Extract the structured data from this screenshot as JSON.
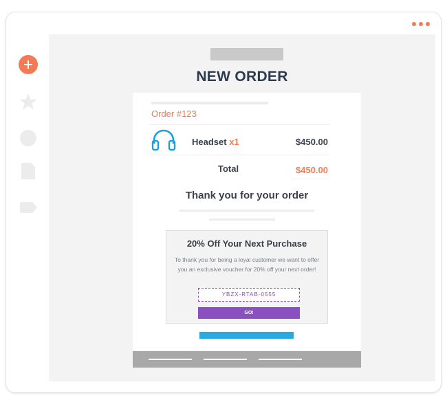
{
  "colors": {
    "accent": "#f47a55",
    "title": "#2d3b4f",
    "voucher_purple": "#8a4fc0",
    "cta_blue": "#2aa8e0",
    "icon_blue": "#1e9ee0"
  },
  "window": {
    "menu_icon": "ellipsis-icon"
  },
  "sidebar": {
    "items": [
      {
        "icon": "plus-icon"
      },
      {
        "icon": "star-icon"
      },
      {
        "icon": "circle-icon"
      },
      {
        "icon": "document-icon"
      },
      {
        "icon": "tag-icon"
      }
    ]
  },
  "main": {
    "title": "NEW ORDER"
  },
  "order": {
    "number": "Order #123",
    "item": {
      "icon": "headset-icon",
      "name": "Headset",
      "qty": "x1",
      "price": "$450.00"
    },
    "total_label": "Total",
    "total_value": "$450.00",
    "thanks": "Thank you for your order"
  },
  "voucher": {
    "title": "20% Off Your Next Purchase",
    "text": "To thank you for being a loyal customer we want to offer you an exclusive voucher for 20% off your next order!",
    "code": "YBZX-RTAB-0555",
    "button": "GO!"
  }
}
